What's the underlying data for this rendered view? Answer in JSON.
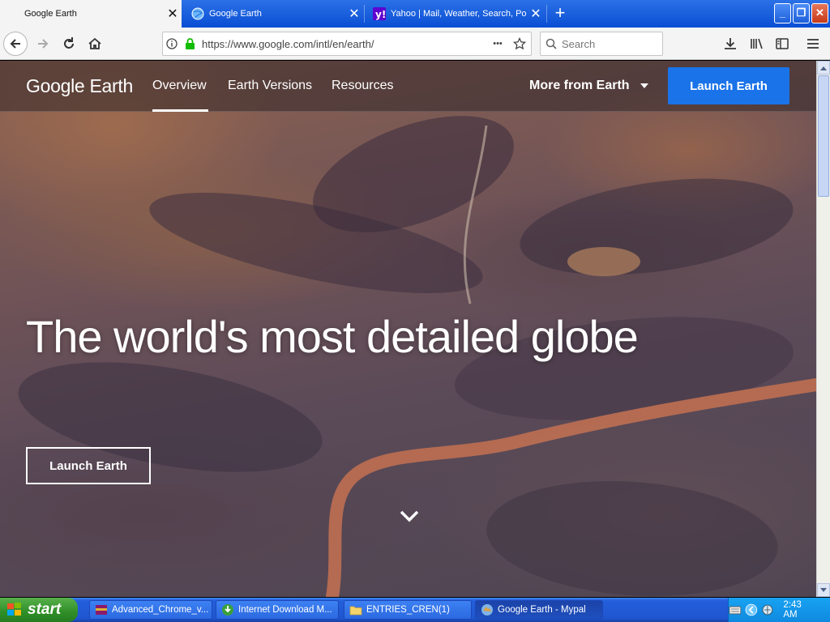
{
  "browser": {
    "tabs": [
      {
        "label": "Google Earth",
        "active": true
      },
      {
        "label": "Google Earth",
        "active": false
      },
      {
        "label": "Yahoo | Mail, Weather, Search, Po",
        "active": false
      }
    ],
    "url": "https://www.google.com/intl/en/earth/",
    "search_placeholder": "Search",
    "url_more": "•••"
  },
  "site": {
    "logo_google": "Google",
    "logo_earth": "Earth",
    "nav": [
      "Overview",
      "Earth Versions",
      "Resources"
    ],
    "more_from": "More from Earth",
    "launch_top": "Launch Earth",
    "hero_title": "The world's most detailed globe",
    "launch_hero": "Launch Earth"
  },
  "taskbar": {
    "start": "start",
    "tasks": [
      {
        "label": "Advanced_Chrome_v..."
      },
      {
        "label": "Internet Download M..."
      },
      {
        "label": "ENTRIES_CREN(1)"
      },
      {
        "label": "Google Earth - Mypal"
      }
    ],
    "clock": "2:43 AM"
  },
  "colors": {
    "accent_blue": "#1a73e8",
    "xp_taskbar": "#245edb",
    "xp_start": "#2f8e27"
  }
}
